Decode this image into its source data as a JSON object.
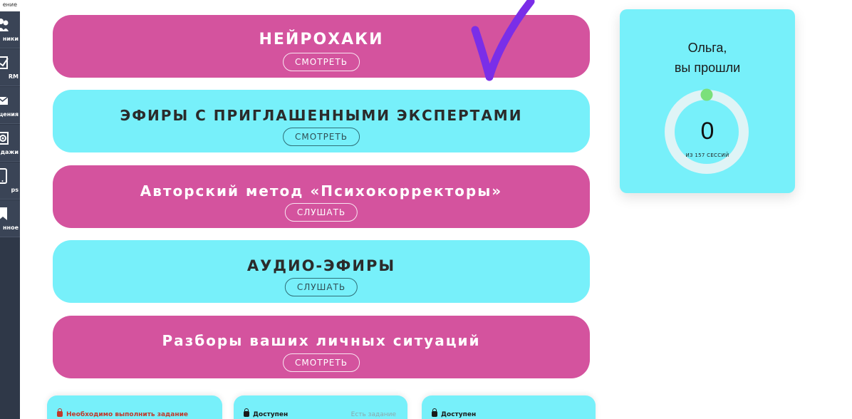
{
  "sidebar": {
    "top_label": "ение",
    "items": [
      {
        "label": "ники",
        "icon": "users-icon"
      },
      {
        "label": "RM",
        "icon": "checkbox-icon"
      },
      {
        "label": "щения",
        "icon": "envelope-icon"
      },
      {
        "label": "дажи",
        "icon": "gear-icon"
      },
      {
        "label": "ps",
        "icon": "phone-icon"
      },
      {
        "label": "нное",
        "icon": "bookmark-icon"
      }
    ]
  },
  "banners": [
    {
      "title": "НЕЙРОХАКИ",
      "button": "СМОТРЕТЬ"
    },
    {
      "title": "ЭФИРЫ С ПРИГЛАШЕННЫМИ ЭКСПЕРТАМИ",
      "button": "СМОТРЕТЬ"
    },
    {
      "title": "Авторский метод «Психокорректоры»",
      "button": "СЛУШАТЬ"
    },
    {
      "title": "АУДИО-ЭФИРЫ",
      "button": "СЛУШАТЬ"
    },
    {
      "title": "Разборы ваших личных ситуаций",
      "button": "СМОТРЕТЬ"
    }
  ],
  "progress": {
    "greeting_line1": "Ольга,",
    "greeting_line2": "вы прошли",
    "completed": "0",
    "total_label": "ИЗ 157 СЕССИЙ",
    "fraction": 0
  },
  "bottom_cards": [
    {
      "status": "Необходимо выполнить задание",
      "extra": "",
      "status_color": "#c0392b"
    },
    {
      "status": "Доступен",
      "extra": "Есть задание",
      "status_color": "#1a1a1a"
    },
    {
      "status": "Доступен",
      "extra": "",
      "status_color": "#1a1a1a"
    }
  ],
  "colors": {
    "pink": "#d4539e",
    "cyan": "#77f0fa",
    "ring_track": "#dff4f6",
    "ring_dot": "#7be07a",
    "checkmark": "#7a2ee8"
  }
}
